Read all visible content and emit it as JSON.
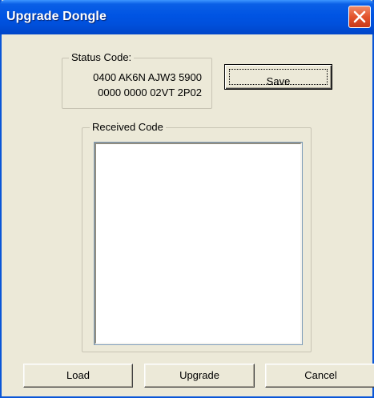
{
  "window": {
    "title": "Upgrade Dongle",
    "close_icon": "close-icon",
    "accent": "#0054e3",
    "close_color": "#e3542c"
  },
  "status": {
    "legend": "Status Code:",
    "line1": "0400 AK6N AJW3 5900",
    "line2": "0000 0000 02VT 2P02",
    "save_label": "Save"
  },
  "received": {
    "legend": "Received Code",
    "value": ""
  },
  "buttons": {
    "load": "Load",
    "upgrade": "Upgrade",
    "cancel": "Cancel"
  }
}
